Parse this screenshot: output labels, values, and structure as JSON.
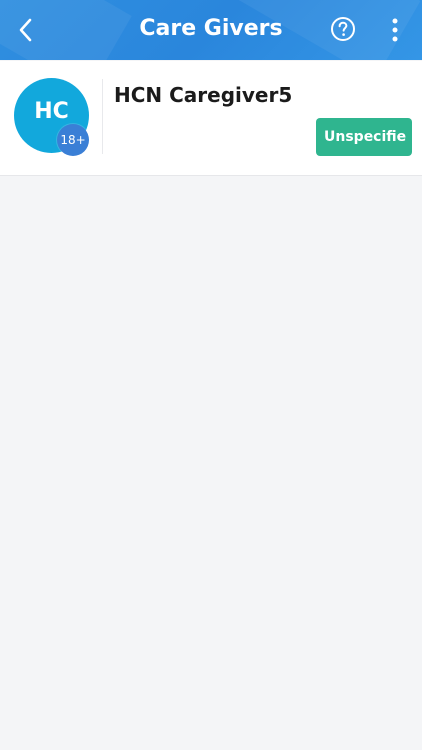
{
  "header": {
    "title": "Care Givers",
    "back_icon": "chevron-left-icon",
    "help_icon": "help-circle-icon",
    "more_icon": "more-vertical-icon",
    "background_color": "#2f8fe0"
  },
  "caregivers": [
    {
      "initials": "HC",
      "age_group": "18+",
      "name": "HCN Caregiver5",
      "status": "Unspecifie",
      "avatar_color": "#12a8dc",
      "badge_color": "#3a7fd6",
      "status_color": "#2fb58f"
    }
  ]
}
